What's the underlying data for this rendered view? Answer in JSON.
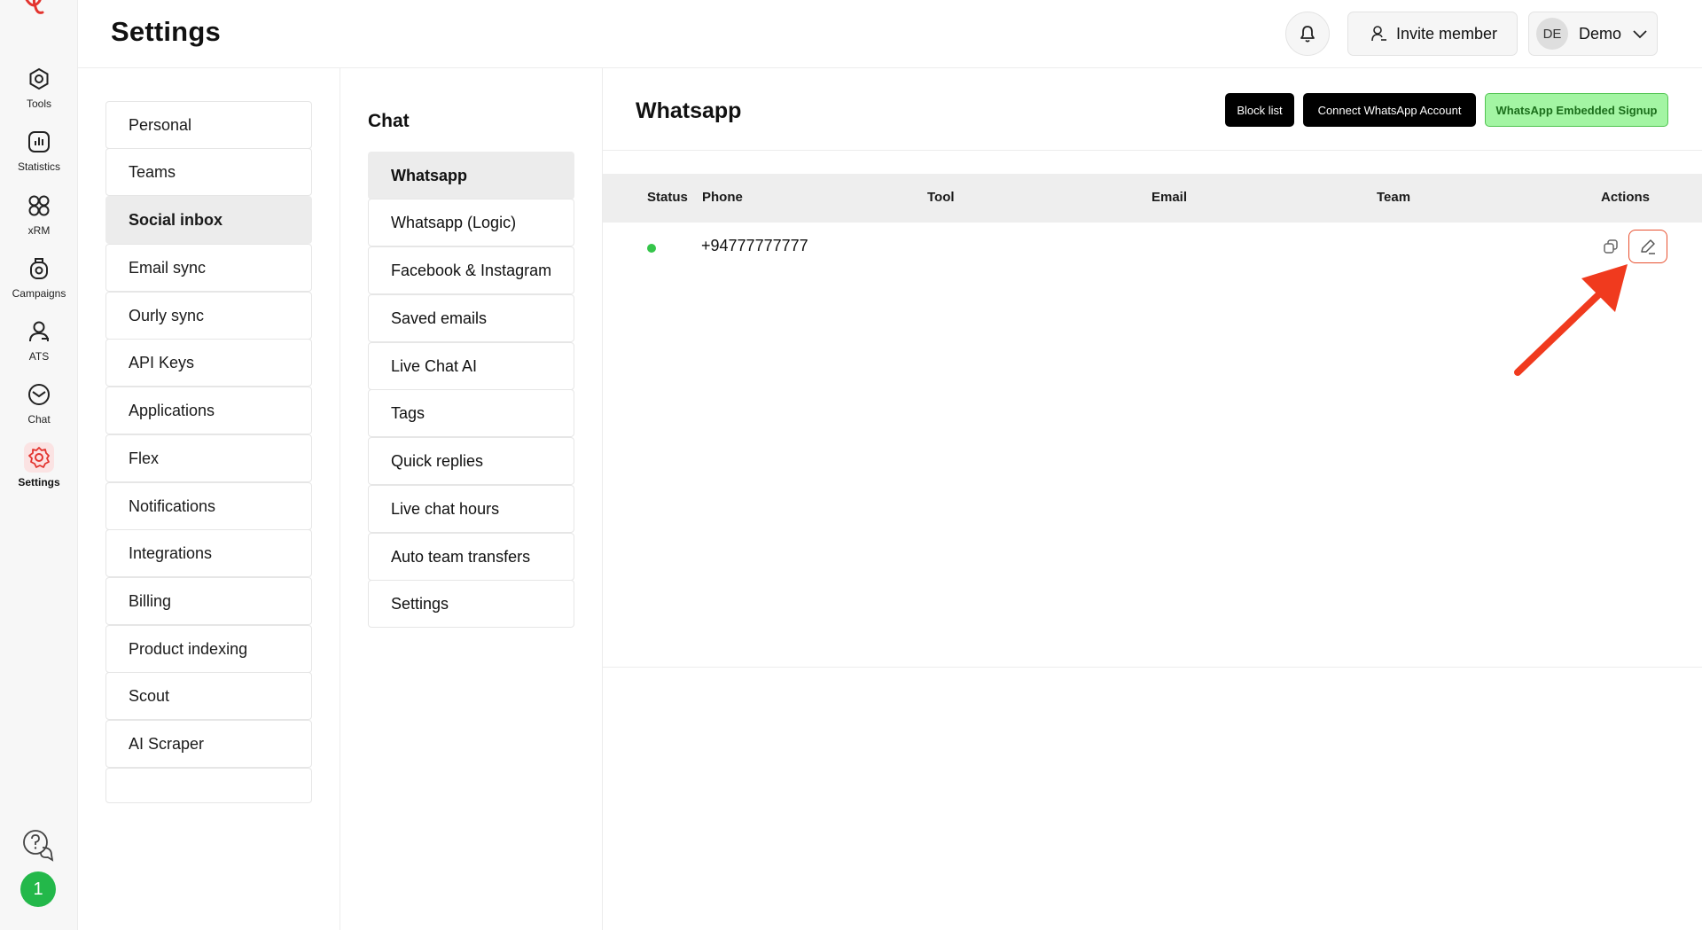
{
  "header": {
    "title": "Settings",
    "invite_label": "Invite member",
    "user_initials": "DE",
    "user_name": "Demo"
  },
  "rail": {
    "items": [
      {
        "label": "Tools",
        "icon": "tools-icon"
      },
      {
        "label": "Statistics",
        "icon": "statistics-icon"
      },
      {
        "label": "xRM",
        "icon": "xrm-icon"
      },
      {
        "label": "Campaigns",
        "icon": "campaigns-icon"
      },
      {
        "label": "ATS",
        "icon": "ats-icon"
      },
      {
        "label": "Chat",
        "icon": "chat-icon"
      },
      {
        "label": "Settings",
        "icon": "settings-icon",
        "active": true
      }
    ],
    "user_badge": "1"
  },
  "settings_nav": {
    "items": [
      "Personal",
      "Teams",
      "Social inbox",
      "Email sync",
      "Ourly sync",
      "API Keys",
      "Applications",
      "Flex",
      "Notifications",
      "Integrations",
      "Billing",
      "Product indexing",
      "Scout",
      "AI Scraper"
    ],
    "active": "Social inbox"
  },
  "chat_menu": {
    "heading": "Chat",
    "items": [
      "Whatsapp",
      "Whatsapp (Logic)",
      "Facebook & Instagram",
      "Saved emails",
      "Live Chat AI",
      "Tags",
      "Quick replies",
      "Live chat hours",
      "Auto team transfers",
      "Settings"
    ],
    "active": "Whatsapp"
  },
  "main": {
    "title": "Whatsapp",
    "buttons": {
      "block_list": "Block list",
      "connect": "Connect WhatsApp Account",
      "embedded": "WhatsApp Embedded Signup"
    },
    "table": {
      "columns": [
        "Status",
        "Phone",
        "Tool",
        "Email",
        "Team",
        "Actions"
      ],
      "rows": [
        {
          "status": "active",
          "status_color": "#35c54a",
          "phone": "+94777777777",
          "tool": "",
          "email": "",
          "team": ""
        }
      ]
    }
  },
  "colors": {
    "accent": "#e8502f",
    "green_button": "#a3f5a3",
    "arrow": "#f03a1e"
  }
}
